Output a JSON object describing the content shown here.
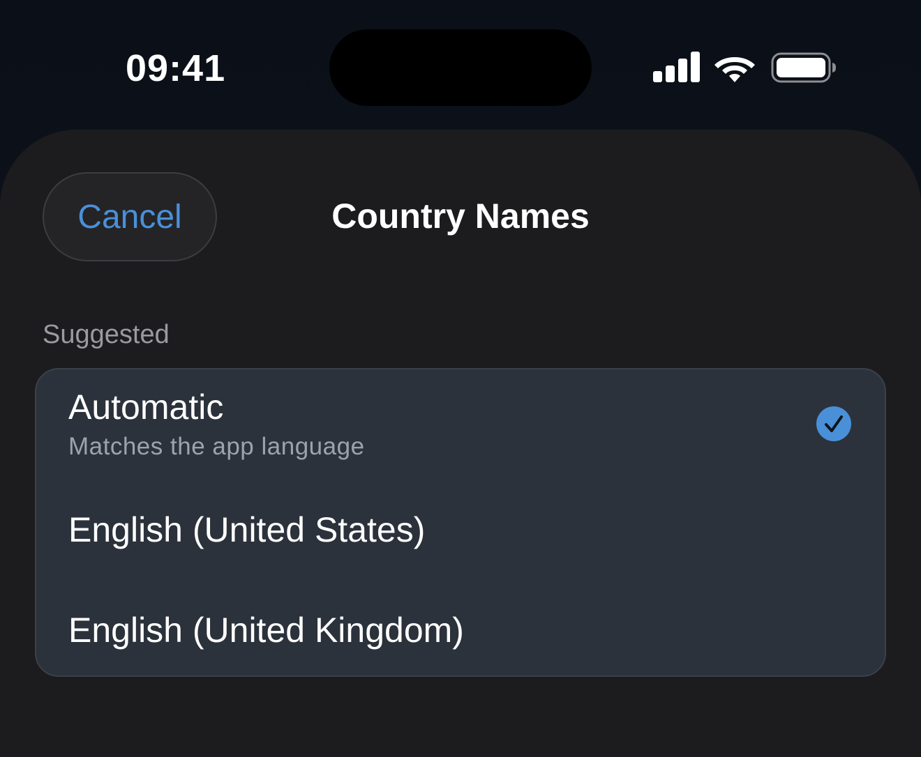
{
  "status_bar": {
    "time": "09:41",
    "icons": [
      "cellular-signal-icon",
      "wifi-icon",
      "battery-icon"
    ]
  },
  "header": {
    "cancel_label": "Cancel",
    "title": "Country Names"
  },
  "section": {
    "header": "Suggested",
    "items": [
      {
        "title": "Automatic",
        "subtitle": "Matches the app language",
        "selected": true
      },
      {
        "title": "English (United States)",
        "selected": false
      },
      {
        "title": "English (United Kingdom)",
        "selected": false
      }
    ]
  },
  "colors": {
    "accent": "#4a90d9",
    "sheet_background": "#1c1c1e",
    "card_background": "#2c323b",
    "secondary_text": "#9da3ab"
  }
}
